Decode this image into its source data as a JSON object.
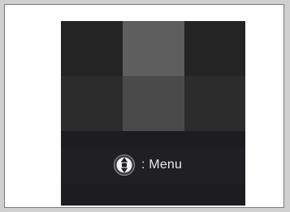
{
  "hint": {
    "separator": ": ",
    "label": "Menu",
    "icon": "up-down-selector-icon"
  },
  "colors": {
    "screen_dark": "#232323",
    "tile_highlight_top": "#5e5e5e",
    "tile_highlight_mid": "#4a4a4a",
    "text": "#e9e9e9"
  }
}
